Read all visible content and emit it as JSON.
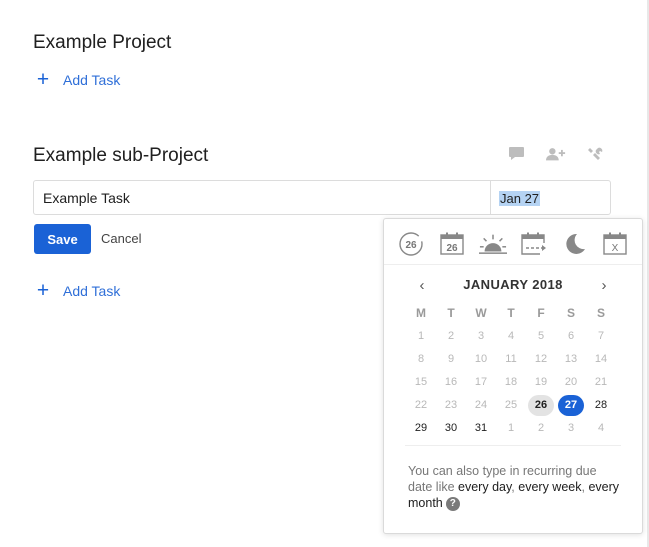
{
  "projects": [
    {
      "title": "Example Project",
      "add_task_label": "Add Task"
    },
    {
      "title": "Example sub-Project",
      "add_task_label": "Add Task"
    }
  ],
  "editor": {
    "task_content": "Example Task",
    "due_date": "Jan 27",
    "save_label": "Save",
    "cancel_label": "Cancel"
  },
  "scheduler": {
    "quick_options": [
      {
        "icon": "today-icon",
        "day": "26"
      },
      {
        "icon": "tomorrow-icon",
        "day": "26"
      },
      {
        "icon": "weekend-icon"
      },
      {
        "icon": "next-week-icon"
      },
      {
        "icon": "postpone-icon"
      },
      {
        "icon": "no-date-icon",
        "label": "X"
      }
    ],
    "month_label": "JANUARY 2018",
    "weekdays": [
      "M",
      "T",
      "W",
      "T",
      "F",
      "S",
      "S"
    ],
    "weeks": [
      [
        "1",
        "2",
        "3",
        "4",
        "5",
        "6",
        "7"
      ],
      [
        "8",
        "9",
        "10",
        "11",
        "12",
        "13",
        "14"
      ],
      [
        "15",
        "16",
        "17",
        "18",
        "19",
        "20",
        "21"
      ],
      [
        "22",
        "23",
        "24",
        "25",
        "26",
        "27",
        "28"
      ],
      [
        "29",
        "30",
        "31",
        "1",
        "2",
        "3",
        "4"
      ]
    ],
    "today": "26",
    "selected": "27",
    "hint": {
      "prefix": "You can also type in recurring due date like ",
      "example1": "every day",
      "sep1": ", ",
      "example2": "every week",
      "sep2": ", ",
      "example3": "every month",
      "help": "?"
    }
  },
  "colors": {
    "accent": "#1a62d6",
    "selected_text_highlight": "#b5d3f3",
    "today_bg": "#e3e3e3"
  }
}
